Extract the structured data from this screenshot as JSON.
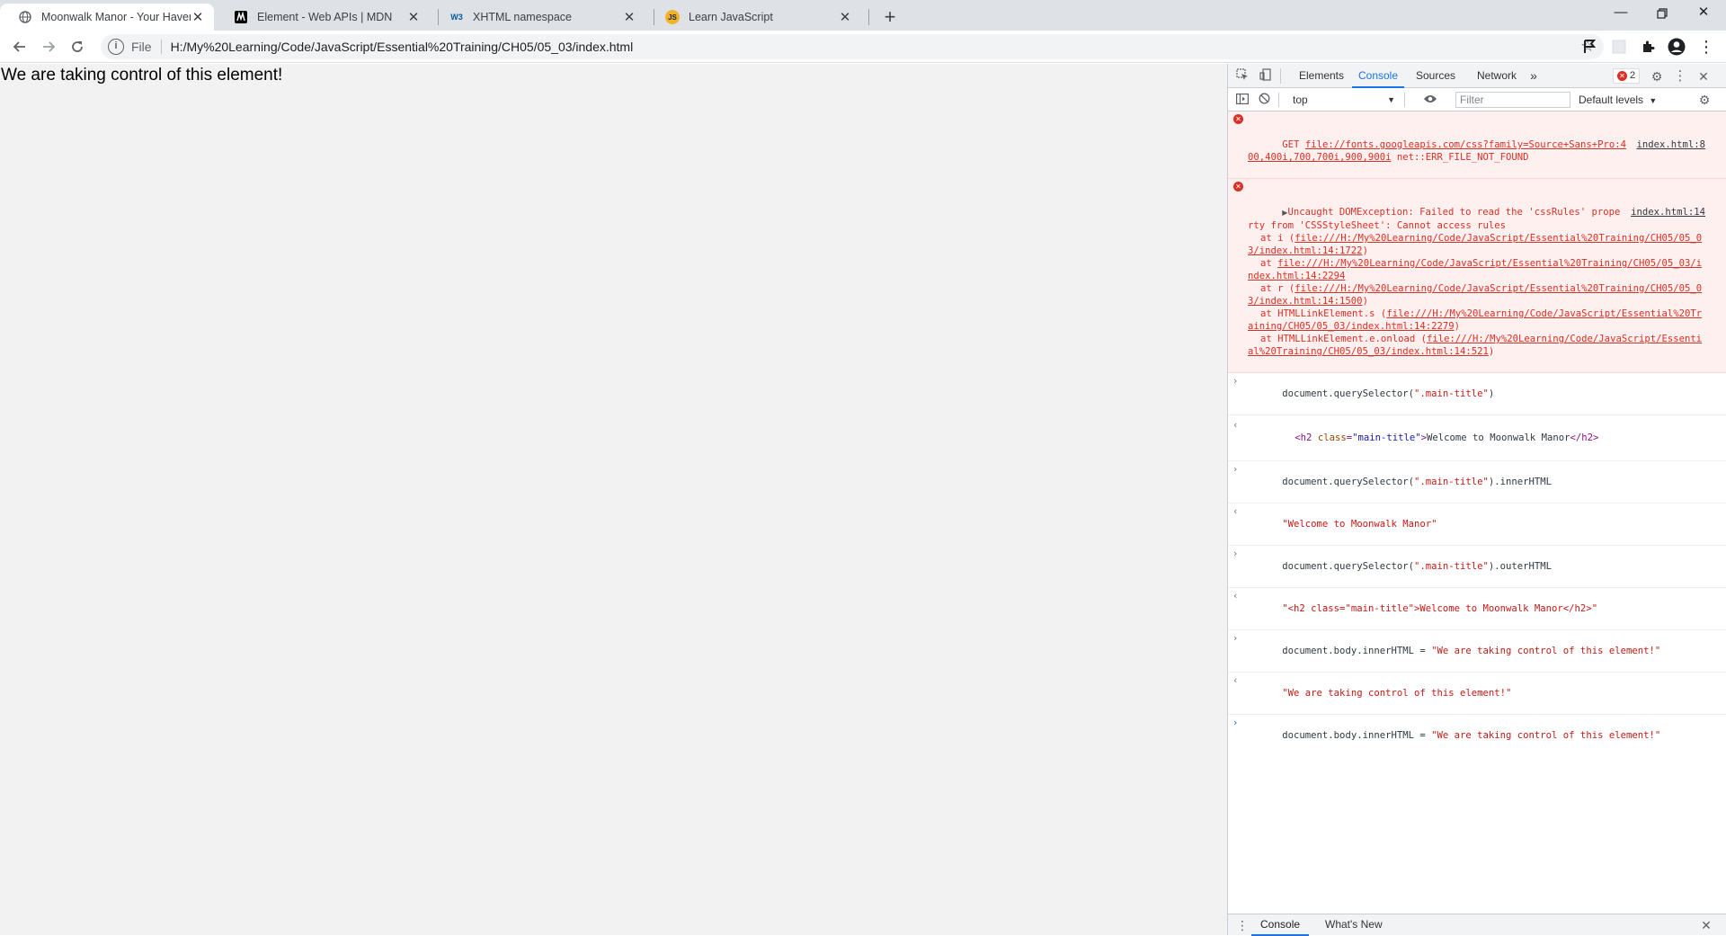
{
  "tabs": [
    {
      "title": "Moonwalk Manor - Your Haven in",
      "favicon": "globe-icon",
      "active": true
    },
    {
      "title": "Element - Web APIs | MDN",
      "favicon": "mdn-icon"
    },
    {
      "title": "XHTML namespace",
      "favicon": "w3c-icon",
      "favicon_text": "W3"
    },
    {
      "title": "Learn JavaScript",
      "favicon": "js-icon",
      "favicon_text": "JS"
    }
  ],
  "toolbar": {
    "scheme_label": "File",
    "url": "H:/My%20Learning/Code/JavaScript/Essential%20Training/CH05/05_03/index.html"
  },
  "page": {
    "body_text": "We are taking control of this element!"
  },
  "devtools": {
    "tabs": [
      "Elements",
      "Console",
      "Sources",
      "Network"
    ],
    "active_tab": "Console",
    "error_count": "2",
    "context": "top",
    "filter_placeholder": "Filter",
    "levels": "Default levels",
    "drawer_tabs": [
      "Console",
      "What's New"
    ],
    "colors": {
      "accent": "#1a73e8",
      "error": "#d93025",
      "error_bg": "#fff0f0"
    }
  },
  "console": {
    "error1": {
      "method": "GET",
      "url": "file://fonts.googleapis.com/css?family=Source+Sans+Pro:400,400i,700,700i,900,900i",
      "status": "net::ERR_FILE_NOT_FOUND",
      "source": "index.html:8"
    },
    "error2": {
      "message": "Uncaught DOMException: Failed to read the 'cssRules' property from 'CSSStyleSheet': Cannot access rules",
      "source": "index.html:14",
      "stack": [
        {
          "prefix": "at i (",
          "url": "file:///H:/My%20Learning/Code/JavaScript/Essential%20Training/CH05/05_03/index.html:14:1722",
          "suffix": ")"
        },
        {
          "prefix": "at ",
          "url": "file:///H:/My%20Learning/Code/JavaScript/Essential%20Training/CH05/05_03/index.html:14:2294",
          "suffix": ""
        },
        {
          "prefix": "at r (",
          "url": "file:///H:/My%20Learning/Code/JavaScript/Essential%20Training/CH05/05_03/index.html:14:1500",
          "suffix": ")"
        },
        {
          "prefix": "at HTMLLinkElement.s (",
          "url": "file:///H:/My%20Learning/Code/JavaScript/Essential%20Training/CH05/05_03/index.html:14:2279",
          "suffix": ")"
        },
        {
          "prefix": "at HTMLLinkElement.e.onload (",
          "url": "file:///H:/My%20Learning/Code/JavaScript/Essential%20Training/CH05/05_03/index.html:14:521",
          "suffix": ")"
        }
      ]
    },
    "cmd1": {
      "pre": "document.querySelector(",
      "str": "\".main-title\"",
      "post": ")"
    },
    "res1": {
      "open_tag": "<h2",
      "attr": "class",
      "attr_value": "\"main-title\"",
      "gt": ">",
      "text": "Welcome to Moonwalk Manor",
      "close_tag": "</h2>"
    },
    "cmd2": {
      "pre": "document.querySelector(",
      "str": "\".main-title\"",
      "post": ").innerHTML"
    },
    "res2": "\"Welcome to Moonwalk Manor\"",
    "cmd3": {
      "pre": "document.querySelector(",
      "str": "\".main-title\"",
      "post": ").outerHTML"
    },
    "res3": "\"<h2 class=\"main-title\">Welcome to Moonwalk Manor</h2>\"",
    "cmd4": {
      "pre": "document.body.innerHTML = ",
      "str": "\"We are taking control of this element!\""
    },
    "res4": "\"We are taking control of this element!\"",
    "prompt": {
      "pre": "document.body.innerHTML = ",
      "str": "\"We are taking control of this element!\""
    }
  }
}
